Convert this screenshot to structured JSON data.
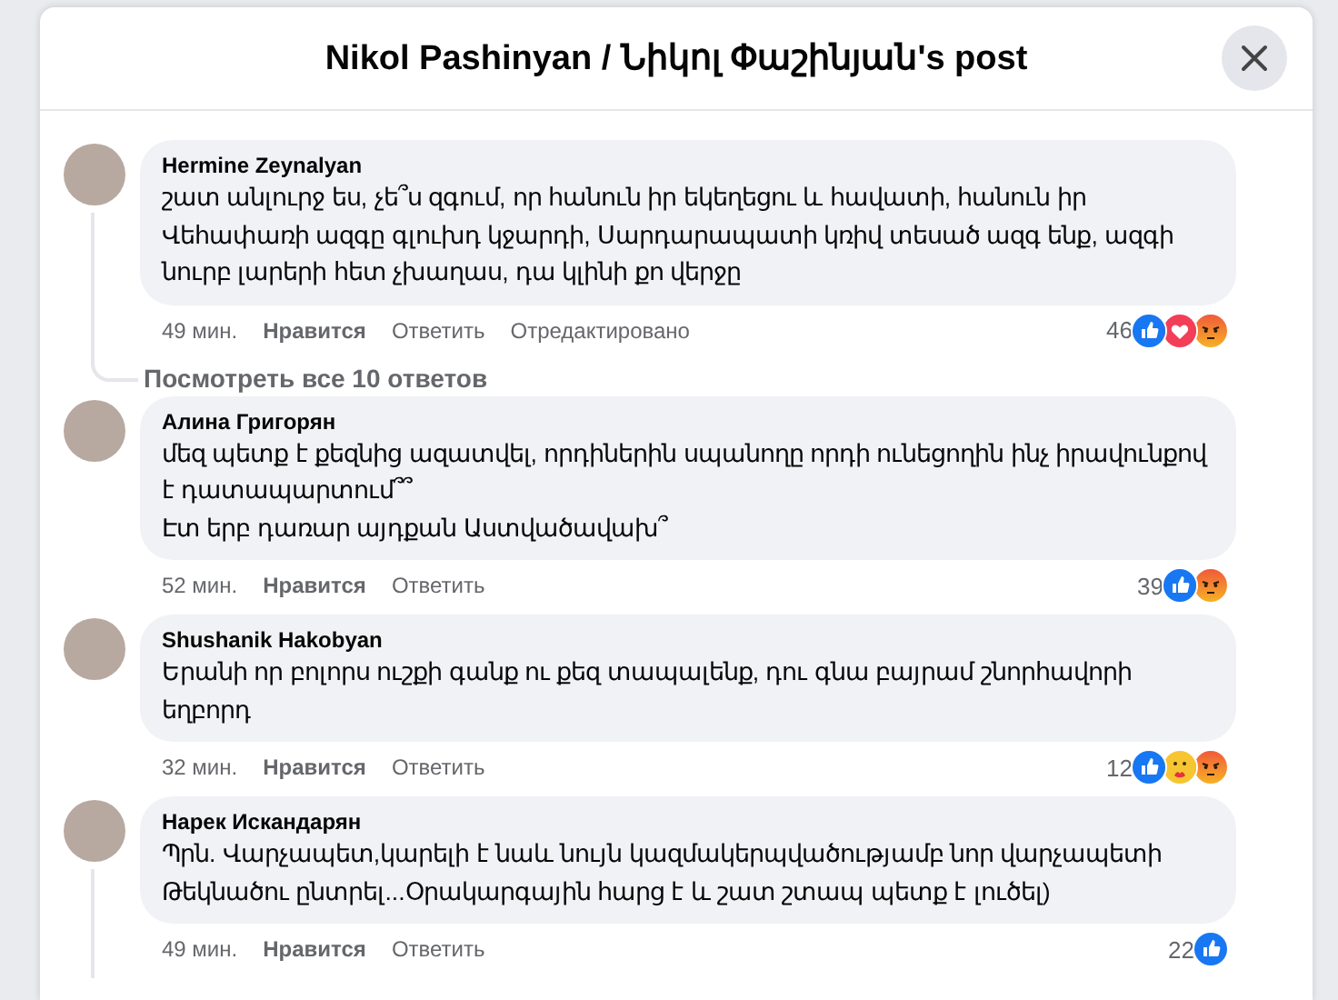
{
  "dialog": {
    "title": "Nikol Pashinyan / Նիկոլ Փաշինյան's post"
  },
  "comments": [
    {
      "author": "Hermine Zeynalyan",
      "paragraphs": [
        "շատ անլուրջ ես, չե՞ս զգում, որ հանուն իր եկեղեցու և հավատի, հանուն իր Վեհափառի ազգը գլուխդ կջարդի, Սարդարապատի կռիվ տեսած ազգ ենք, ազգի նուրբ լարերի հետ չխաղաս, դա կլինի քո վերջը"
      ],
      "time": "49 мин.",
      "like_label": "Нравится",
      "reply_label": "Ответить",
      "edited_label": "Отредактировано",
      "reaction_count": "46",
      "reactions": [
        {
          "kind": "like"
        },
        {
          "kind": "love"
        },
        {
          "kind": "angry"
        }
      ],
      "thread": true,
      "view_replies": "Посмотреть все 10 ответов"
    },
    {
      "author": "Алина Григорян",
      "paragraphs": [
        "մեզ պետք է քեզնից ազատվել, որդիներին սպանողը որդի ունեցողին ինչ իրավունքով է դատապարտում՞՞",
        "Էտ երբ դառար այդքան Աստվածավախ՞"
      ],
      "time": "52 мин.",
      "like_label": "Нравится",
      "reply_label": "Ответить",
      "reaction_count": "39",
      "reactions": [
        {
          "kind": "like"
        },
        {
          "kind": "angry"
        }
      ],
      "thread": false
    },
    {
      "author": "Shushanik Hakobyan",
      "paragraphs": [
        "Երանի որ բոլորս ուշքի գանք ու քեզ տապալենք, դու գնա բայրամ շնորհավորի եղբորդ"
      ],
      "time": "32 мин.",
      "like_label": "Нравится",
      "reply_label": "Ответить",
      "reaction_count": "12",
      "reactions": [
        {
          "kind": "like"
        },
        {
          "kind": "care"
        },
        {
          "kind": "angry"
        }
      ],
      "thread": false
    },
    {
      "author": "Нарек Искандарян",
      "paragraphs": [
        "Պրն. Վարչապետ,կարելի է նաև նույն կազմակերպվածությամբ նոր վարչապետի Թեկնածու ընտրել...Օրակարգային հարց է և շատ շտապ պետք է լուծել)"
      ],
      "time": "49 мин.",
      "like_label": "Нравится",
      "reply_label": "Ответить",
      "reaction_count": "22",
      "reactions": [
        {
          "kind": "like"
        }
      ],
      "thread": true
    }
  ]
}
